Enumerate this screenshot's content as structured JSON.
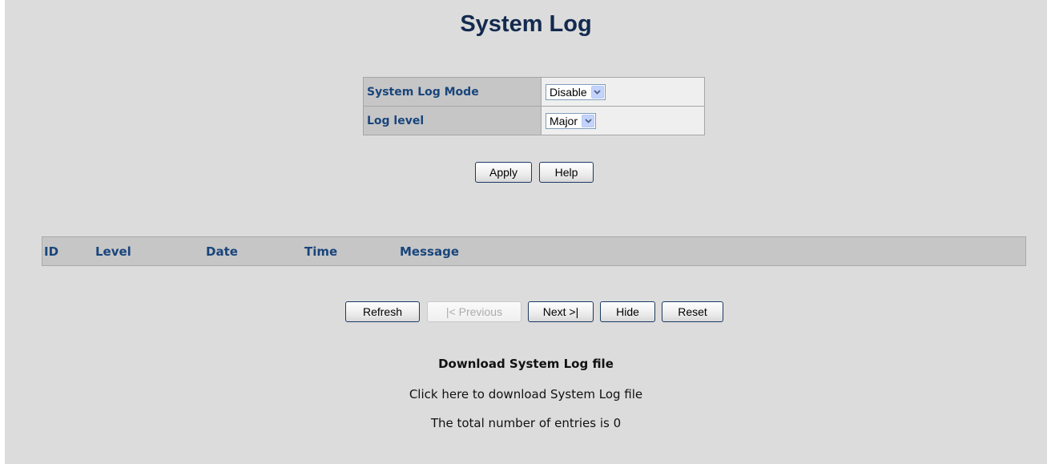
{
  "page": {
    "title": "System Log"
  },
  "settings": {
    "rows": [
      {
        "label": "System Log Mode",
        "value": "Disable"
      },
      {
        "label": "Log level",
        "value": "Major"
      }
    ]
  },
  "buttons": {
    "apply": "Apply",
    "help": "Help"
  },
  "log_table": {
    "columns": [
      "ID",
      "Level",
      "Date",
      "Time",
      "Message"
    ],
    "rows": []
  },
  "nav_buttons": {
    "refresh": "Refresh",
    "previous": "|< Previous",
    "next": "Next >|",
    "hide": "Hide",
    "reset": "Reset"
  },
  "download": {
    "heading": "Download System Log file",
    "link_text": "Click here to download System Log file",
    "total_entries": "The total number of entries is 0"
  },
  "colors": {
    "title": "#132a4f",
    "label_text": "#19457c",
    "header_bg": "#c6c6c6",
    "page_bg": "#dcdcdc"
  }
}
